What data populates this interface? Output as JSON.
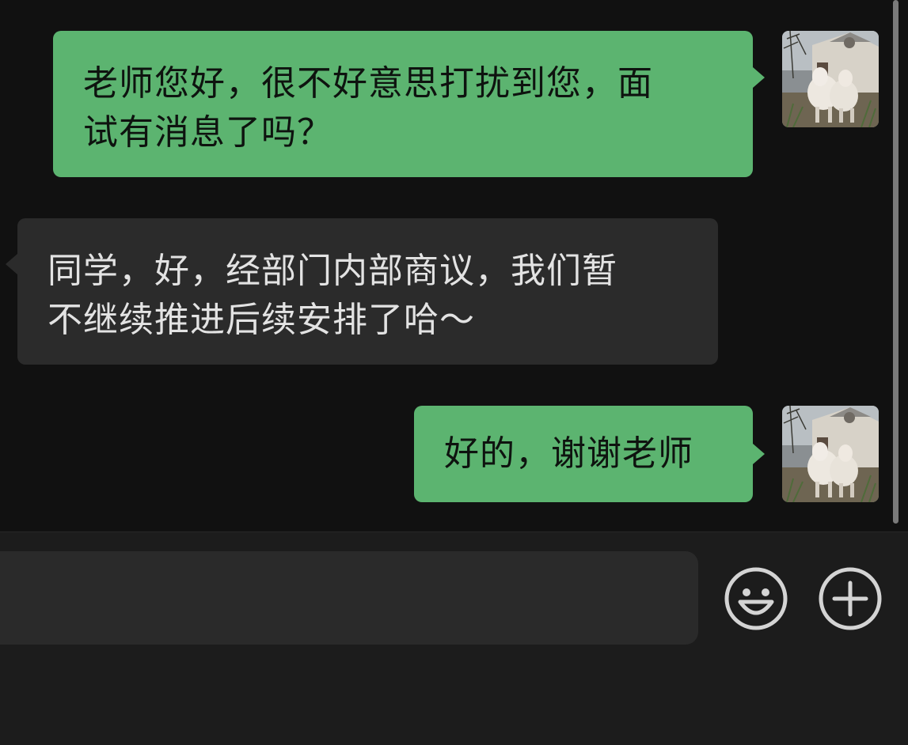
{
  "conversation": {
    "messages": [
      {
        "sender": "me",
        "lines": [
          "老师您好，很不好意思打扰到您，面",
          "试有消息了吗？"
        ]
      },
      {
        "sender": "other",
        "lines": [
          "同学，好，经部门内部商议，我们暂",
          "不继续推进后续安排了哈～"
        ]
      },
      {
        "sender": "me",
        "lines": [
          "好的，谢谢老师"
        ]
      }
    ]
  },
  "composer": {
    "input_value": "",
    "emoji_icon": "smiley-face-icon",
    "more_icon": "plus-circle-icon"
  },
  "colors": {
    "background": "#111111",
    "my_bubble": "#5cb470",
    "their_bubble": "#2b2b2b",
    "input_bar": "#1c1c1c",
    "input_field": "#2a2a2a"
  }
}
